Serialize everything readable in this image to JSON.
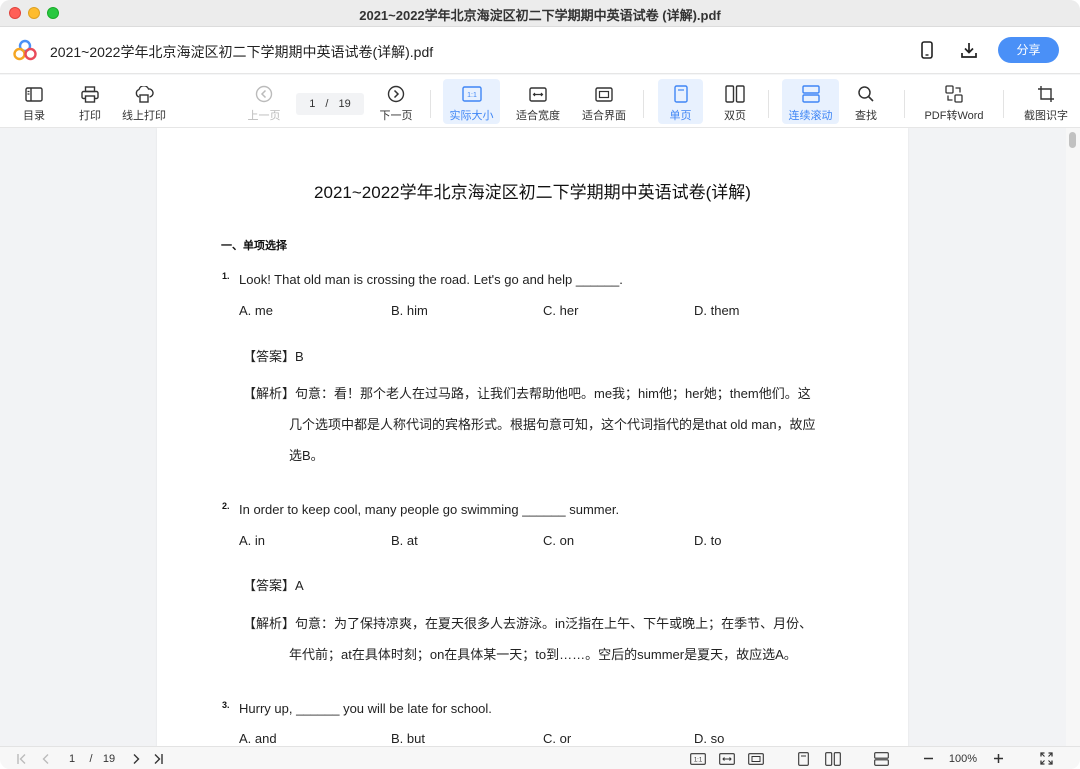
{
  "window": {
    "title": "2021~2022学年北京海淀区初二下学期期中英语试卷 (详解).pdf"
  },
  "header": {
    "doc_title": "2021~2022学年北京海淀区初二下学期期中英语试卷(详解).pdf",
    "share_label": "分享",
    "icons": [
      "phone-icon",
      "download-icon"
    ]
  },
  "toolbar": {
    "contents": "目录",
    "print": "打印",
    "online_print": "线上打印",
    "prev_page": "上一页",
    "current_page": "1",
    "page_sep": "/",
    "total_pages": "19",
    "next_page": "下一页",
    "actual_size": "实际大小",
    "fit_width": "适合宽度",
    "fit_page": "适合界面",
    "single_page": "单页",
    "double_page": "双页",
    "continuous_scroll": "连续滚动",
    "find": "查找",
    "pdf_to_word": "PDF转Word",
    "ocr": "截图识字",
    "actual_size_badge": "1:1",
    "accent": "#3f86f5"
  },
  "document": {
    "title": "2021~2022学年北京海淀区初二下学期期中英语试卷(详解)",
    "section": "一、单项选择",
    "questions": [
      {
        "num": "1.",
        "text": "Look! That old man is crossing the road. Let's go and help ______.",
        "options": [
          "A. me",
          "B. him",
          "C. her",
          "D. them"
        ],
        "answer": "【答案】B",
        "explanation": [
          "【解析】句意：看！那个老人在过马路，让我们去帮助他吧。me我；him他；her她；them他们。这",
          "几个选项中都是人称代词的宾格形式。根据句意可知，这个代词指代的是that old man，故应",
          "选B。"
        ]
      },
      {
        "num": "2.",
        "text": "In order to keep cool, many people go swimming ______ summer.",
        "options": [
          "A. in",
          "B. at",
          "C. on",
          "D. to"
        ],
        "answer": "【答案】A",
        "explanation": [
          "【解析】句意：为了保持凉爽，在夏天很多人去游泳。in泛指在上午、下午或晚上；在季节、月份、",
          "年代前；at在具体时刻；on在具体某一天；to到……。空后的summer是夏天，故应选A。"
        ]
      },
      {
        "num": "3.",
        "text": "Hurry up, ______ you will be late for school.",
        "options": [
          "A. and",
          "B. but",
          "C. or",
          "D. so"
        ]
      }
    ]
  },
  "bottombar": {
    "current_page": "1",
    "page_sep": "/",
    "total_pages": "19",
    "zoom": "100%",
    "actual_size_badge": "1:1"
  }
}
